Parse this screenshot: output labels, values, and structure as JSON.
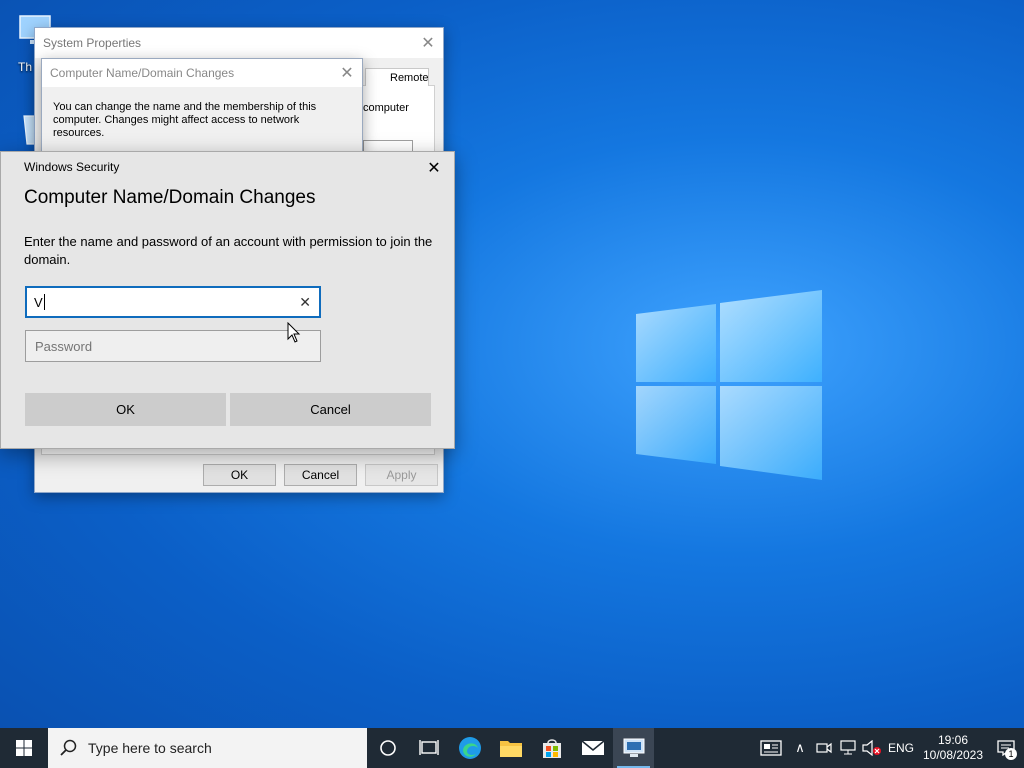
{
  "desktop": {
    "icon_this_pc_label": "Th",
    "icon_recycle_bin_label": ""
  },
  "system_properties": {
    "title": "System Properties",
    "tab_remote": "Remote",
    "partial_text": "computer",
    "ok_label": "OK",
    "cancel_label": "Cancel",
    "apply_label": "Apply"
  },
  "name_domain_changes": {
    "title": "Computer Name/Domain Changes",
    "description": "You can change the name and the membership of this computer. Changes might affect access to network resources."
  },
  "windows_security": {
    "caption": "Windows Security",
    "heading": "Computer Name/Domain Changes",
    "description": "Enter the name and password of an account with permission to join the domain.",
    "username_value": "V",
    "password_placeholder": "Password",
    "ok_label": "OK",
    "cancel_label": "Cancel"
  },
  "taskbar": {
    "search_placeholder": "Type here to search",
    "language": "ENG",
    "time": "19:06",
    "date": "10/08/2023",
    "notification_count": "1"
  },
  "colors": {
    "accent": "#0f6cbd",
    "taskbar": "#1f2a35",
    "desktop": "#1477e0"
  }
}
